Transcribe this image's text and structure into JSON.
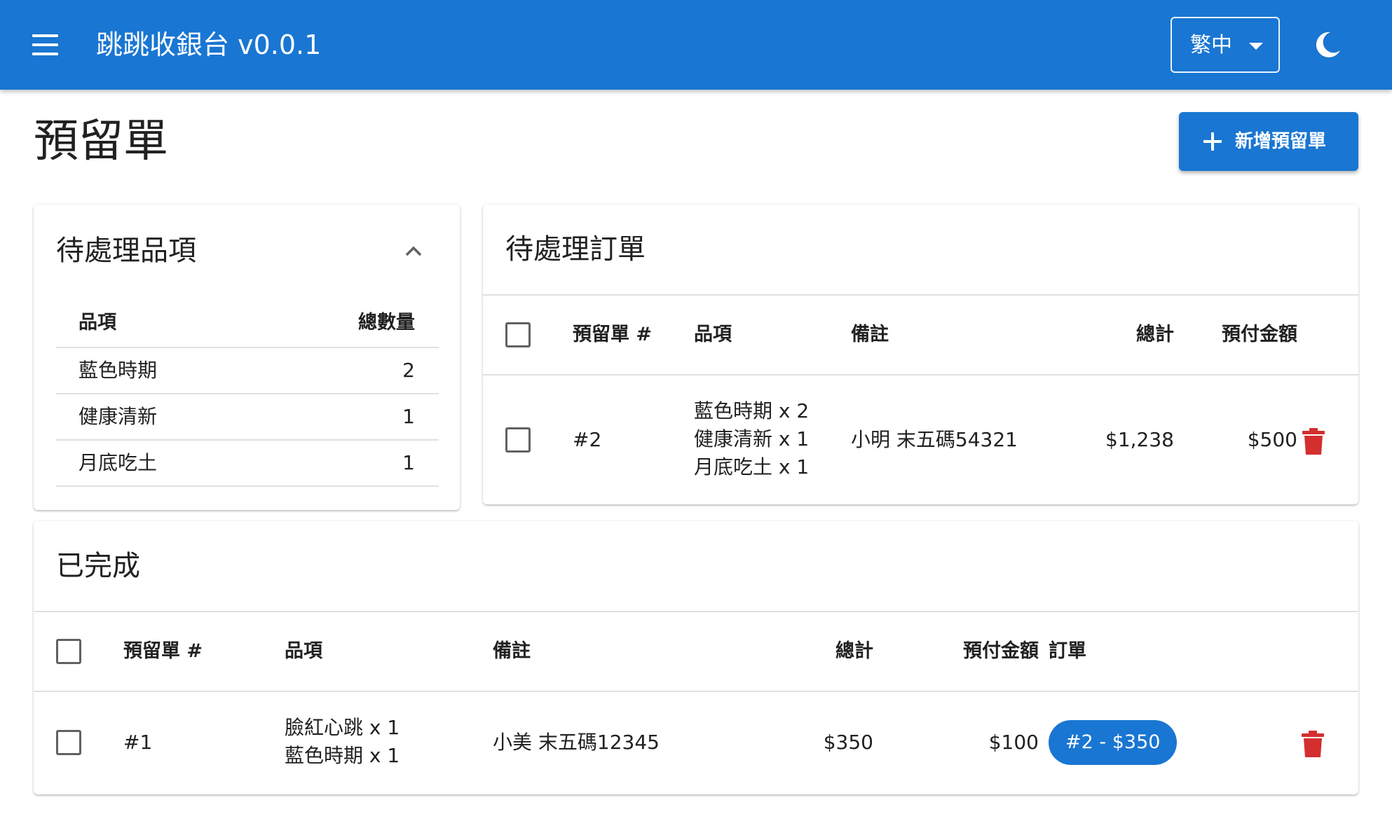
{
  "app": {
    "title": "跳跳收銀台 v0.0.1",
    "language": "繁中",
    "brand_color": "#1976d2",
    "danger_color": "#d32f2f"
  },
  "page": {
    "title": "預留單",
    "add_button_label": "新增預留單"
  },
  "pending_items": {
    "title": "待處理品項",
    "columns": [
      "品項",
      "總數量"
    ],
    "rows": [
      {
        "item": "藍色時期",
        "qty": "2"
      },
      {
        "item": "健康清新",
        "qty": "1"
      },
      {
        "item": "月底吃土",
        "qty": "1"
      }
    ]
  },
  "pending_orders": {
    "title": "待處理訂單",
    "columns": [
      "預留單 #",
      "品項",
      "備註",
      "總計",
      "預付金額"
    ],
    "rows": [
      {
        "id": "#2",
        "items": [
          "藍色時期 x 2",
          "健康清新 x 1",
          "月底吃土 x 1"
        ],
        "note": "小明 末五碼54321",
        "total": "$1,238",
        "prepaid": "$500"
      }
    ]
  },
  "completed": {
    "title": "已完成",
    "columns": [
      "預留單 #",
      "品項",
      "備註",
      "總計",
      "預付金額",
      "訂單"
    ],
    "rows": [
      {
        "id": "#1",
        "items": [
          "臉紅心跳 x 1",
          "藍色時期 x 1"
        ],
        "note": "小美 末五碼12345",
        "total": "$350",
        "prepaid": "$100",
        "order": "#2 - $350"
      }
    ]
  }
}
